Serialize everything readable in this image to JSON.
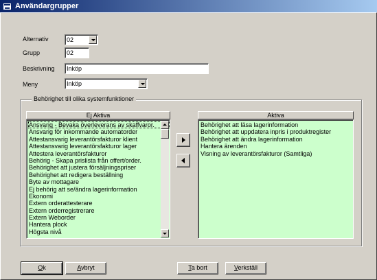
{
  "window": {
    "title": "Användargrupper"
  },
  "form": {
    "alternativ": {
      "label": "Alternativ",
      "value": "02"
    },
    "grupp": {
      "label": "Grupp",
      "value": "02"
    },
    "beskrivning": {
      "label": "Beskrivning",
      "value": "Inköp"
    },
    "meny": {
      "label": "Meny",
      "value": "Inköp"
    }
  },
  "group": {
    "legend": "Behörighet till olika systemfunktioner",
    "ej_aktiva": {
      "header": "Ej Aktiva",
      "items": [
        "Ansvarig - Bevaka överleverans av skaffvaror.",
        "Ansvarig för inkommande automatorder",
        "Attestansvarig leverantörsfakturor klient",
        "Attestansvarig leverantörsfakturor lager",
        "Attestera leverantörsfakturor",
        "Behörig - Skapa prislista från offert/order.",
        "Behörighet att justera försäljningspriser",
        "Behörighet att redigera beställning",
        "Byte av mottagare",
        "Ej behörig att se/ändra lagerinformation",
        "Ekonomi",
        "Extern orderattesterare",
        "Extern orderregistrerare",
        "Extern Weborder",
        "Hantera plock",
        "Högsta nivå"
      ]
    },
    "aktiva": {
      "header": "Aktiva",
      "items": [
        "Behörighet att läsa lagerinformation",
        "Behörighet att uppdatera inpris i produktregister",
        "Behörighet att ändra lagerinformation",
        "Hantera ärenden",
        "Visning av leverantörsfakturor (Samtliga)"
      ]
    }
  },
  "buttons": {
    "ok": {
      "u": "O",
      "rest": "k"
    },
    "avbryt": {
      "u": "A",
      "rest": "vbryt"
    },
    "ta_bort": {
      "u": "T",
      "rest": "a bort"
    },
    "verkstall": {
      "u": "V",
      "rest": "erkställ"
    }
  },
  "colors": {
    "list_bg": "#ccffcc",
    "titlebar": "#0a246a",
    "face": "#d4d0c8"
  }
}
